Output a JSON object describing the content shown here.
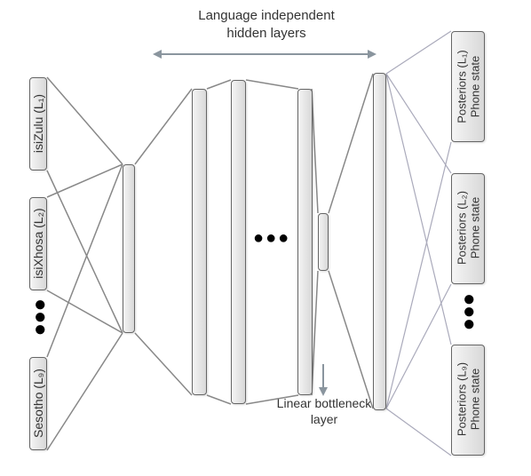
{
  "header": {
    "top_label_line1": "Language independent",
    "top_label_line2": "hidden layers"
  },
  "inputs": [
    {
      "label": "isiZulu (L₁)"
    },
    {
      "label": "isiXhosa (L₂)"
    },
    {
      "label": "Sesotho (L₉)"
    }
  ],
  "outputs": [
    {
      "line1": "Phone state",
      "line2": "Posteriors (L₁)"
    },
    {
      "line1": "Phone state",
      "line2": "Posteriors (L₂)"
    },
    {
      "line1": "Phone state",
      "line2": "Posteriors (L₉)"
    }
  ],
  "bottleneck": {
    "label_line1": "Linear bottleneck",
    "label_line2": "layer"
  },
  "middle_ellipsis": "●●●",
  "input_ellipsis": "●",
  "output_ellipsis": "●"
}
